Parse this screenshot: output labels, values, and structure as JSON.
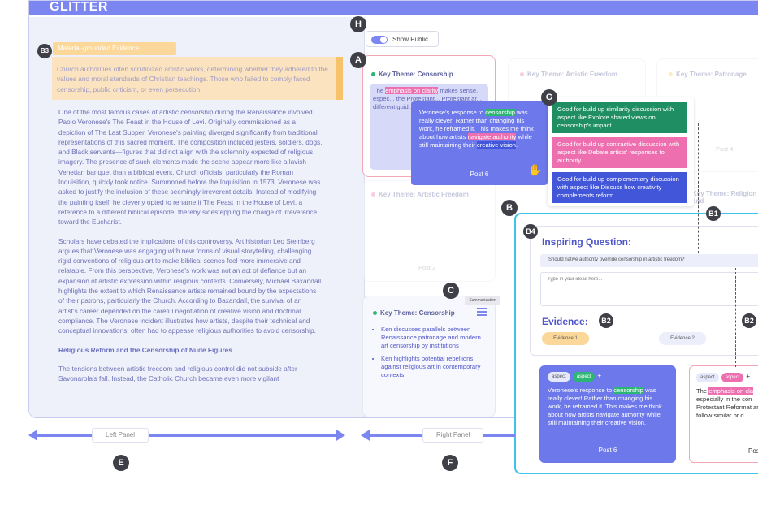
{
  "app": {
    "title": "GLITTER"
  },
  "left_panel": {
    "evidence_tag": "Material-grounded Evidence",
    "highlight_text": "Church authorities often scrutinized artistic works, determining whether they adhered to the values and moral standards of Christian teachings. Those who failed to comply faced censorship, public criticism, or even persecution.",
    "paragraphs": [
      "One of the most famous cases of artistic censorship during the Renaissance involved Paolo Veronese's The Feast in the House of Levi. Originally commissioned as a depiction of The Last Supper, Veronese's painting diverged significantly from traditional representations of this sacred moment. The composition included jesters, soldiers, dogs, and Black servants—figures that did not align with the solemnity expected of religious imagery. The presence of such elements made the scene appear more like a lavish Venetian banquet than a biblical event. Church officials, particularly the Roman Inquisition, quickly took notice. Summoned before the Inquisition in 1573, Veronese was asked to justify the inclusion of these seemingly irreverent details. Instead of modifying the painting itself, he cleverly opted to rename it The Feast in the House of Levi, a reference to a different biblical episode, thereby sidestepping the charge of irreverence toward the Eucharist.",
      "Scholars have debated the implications of this controversy. Art historian Leo Steinberg argues that Veronese was engaging with new forms of visual storytelling, challenging rigid conventions of religious art to make biblical scenes feel more immersive and relatable. From this perspective, Veronese's work was not an act of defiance but an expansion of artistic expression within religious contexts. Conversely, Michael Baxandall highlights the extent to which Renaissance artists remained bound by the expectations of their patrons, particularly the Church. According to Baxandall, the survival of an artist's career depended on the careful negotiation of creative vision and doctrinal compliance. The Veronese incident illustrates how artists, despite their technical and conceptual innovations, often had to appease religious authorities to avoid censorship."
    ],
    "section_heading": "Religious Reform and the Censorship of Nude Figures",
    "last_paragraph": "The tensions between artistic freedom and religious control did not subside after Savonarola's fall. Instead, the Catholic Church became even more vigilant"
  },
  "toggle": {
    "label": "Show Public"
  },
  "themes": {
    "censorship": "Key Theme: Censorship",
    "artistic_freedom": "Key Theme: Artistic Freedom",
    "patronage": "Key Theme: Patronage",
    "religion": "Key Theme: Religion and",
    "censorship2": "Key Theme: Censorship"
  },
  "card_a": {
    "pre": "The ",
    "mark": "emphasis on clarity",
    "rest": " makes sense, espec... the Protestant... Protestant ar... different guid..."
  },
  "post6_popup": {
    "t1": "Veronese's response to ",
    "m1": "censorship",
    "t2": " was really clever! Rather than changing his work, he reframed it. This makes me think about how artists ",
    "m2": "navigate authority",
    "t3": " while still maintaining their ",
    "m3": "creative vision",
    "t4": ".",
    "label": "Post 6"
  },
  "hints": [
    "Good for build up similarity discussion with aspect like Explore shared views on censorship's impact.",
    "Good for build up contrastive discussion with aspect like Debate artists' responses to authority.",
    "Good for build up complementary discussion with aspect like Discuss how creativity complements reform."
  ],
  "faded_posts": {
    "post4": "Post 4",
    "post2": "Post 2"
  },
  "summary": {
    "tooltip": "Summarization",
    "bullets": [
      "Ken discusses parallels between Renaissance patronage and modern art censorship by institutions",
      "Ken highlights potential rebellions against religious art in contemporary contexts"
    ]
  },
  "composer": {
    "title": "Inspiring Question:",
    "question": "Should native authority override censorship in artistic freedom?",
    "placeholder": "Type in your ideas here...",
    "evidence_label": "Evidence:",
    "evidence1": "Evidence 1",
    "evidence2": "Evidence 2"
  },
  "post_card_b": {
    "pill1": "aspect",
    "pill2": "aspect",
    "plus": "+",
    "t1": "Veronese's response to ",
    "m1": "censorship",
    "t2": " was really clever! Rather than changing his work, he reframed it. This makes me think about how artists navigate authority while still maintaining their creative vision.",
    "label": "Post 6"
  },
  "post_card_c": {
    "pill1": "aspect",
    "pill2": "aspect",
    "plus": "+",
    "t1": "The ",
    "m1": "emphasis on cla",
    "t2": "especially in the con Protestant Reformat art follow similar or d",
    "label": "Pos"
  },
  "panels": {
    "left": "Left Panel",
    "right": "Right Panel"
  },
  "badges": {
    "a": "A",
    "b": "B",
    "b1": "B1",
    "b2": "B2",
    "b3": "B3",
    "b4": "B4",
    "c": "C",
    "e": "E",
    "f": "F",
    "g": "G",
    "h": "H"
  },
  "colors": {
    "accent": "#7c86f0",
    "post_blue": "#6d79ea",
    "highlight_green": "#2bb673",
    "highlight_pink": "#ee6fb0",
    "highlight_blue": "#4256d9",
    "evidence_orange": "#fcd79a",
    "composer_border": "#3fc3ec"
  }
}
